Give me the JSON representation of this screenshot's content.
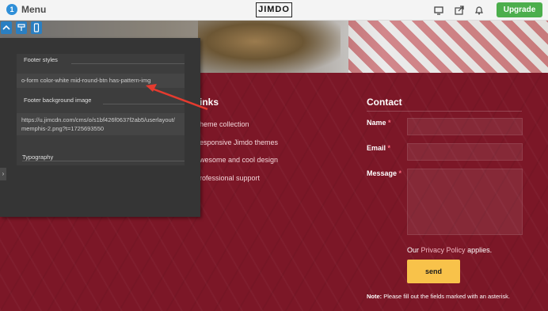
{
  "topbar": {
    "menu_badge": "1",
    "menu_label": "Menu",
    "logo": "JIMDO",
    "upgrade_label": "Upgrade",
    "icons": [
      "desktop-icon",
      "share-icon",
      "bell-icon"
    ]
  },
  "footer": {
    "links_heading": "inks",
    "links": [
      "heme collection",
      "esponsive Jimdo themes",
      "wesome and cool design",
      "rofessional support"
    ],
    "contact_heading": "Contact",
    "form": {
      "name_label": "Name",
      "email_label": "Email",
      "message_label": "Message",
      "required_mark": "*"
    },
    "privacy_prefix": "Our",
    "privacy_link": "Privacy Policy",
    "privacy_suffix": "applies.",
    "send_label": "send",
    "note_bold": "Note:",
    "note_text": "Please fill out the fields marked with an asterisk."
  },
  "editor": {
    "footer_styles_title": "Footer styles",
    "footer_styles_value": "o-form color-white mid-round-btn has-pattern-img",
    "bg_image_title": "Footer background image",
    "bg_image_value": "https://u.jimcdn.com/cms/o/s1bf426f0637f2ab5/userlayout/ memphis-2.png?t=1725693550",
    "typography_title": "Typography"
  },
  "colors": {
    "footer_bg": "#7c1727",
    "send_button": "#f8c24a",
    "upgrade_button": "#4cae4c",
    "panel_bg": "#353535",
    "annotation_arrow": "#e53b2f"
  }
}
